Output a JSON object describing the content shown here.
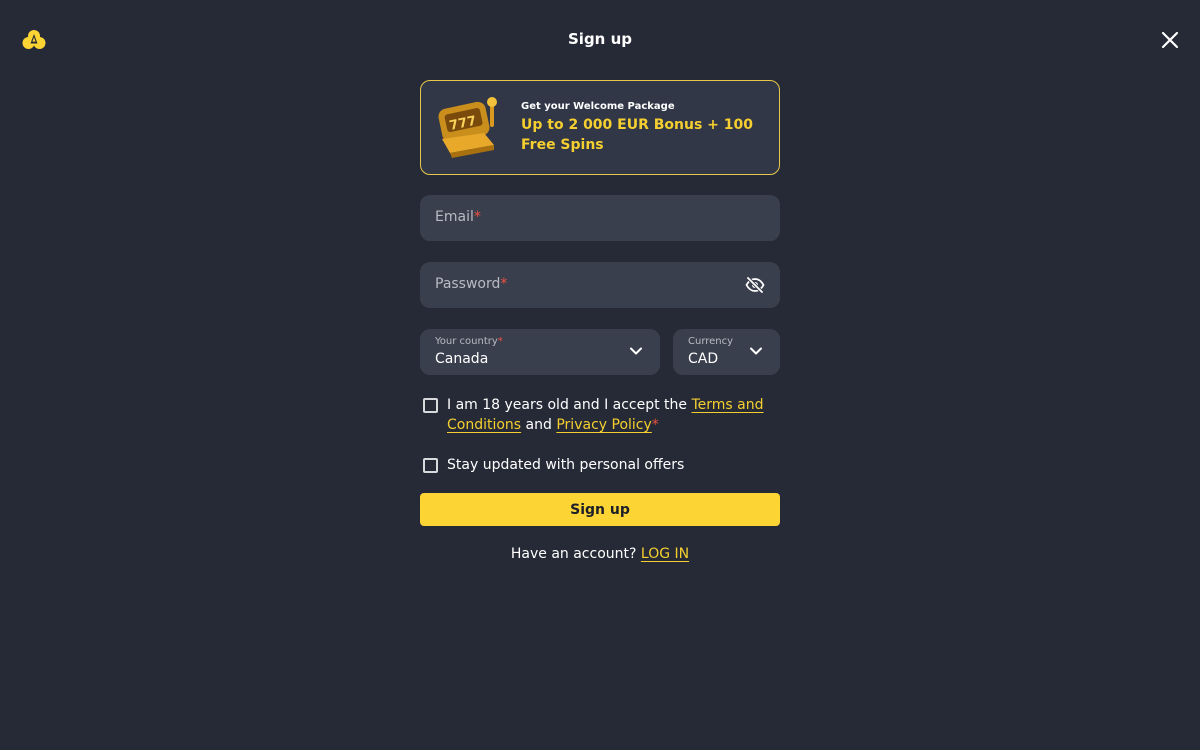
{
  "header": {
    "title": "Sign up",
    "accent_color": "#fcd535"
  },
  "promo": {
    "small_text": "Get your Welcome Package",
    "big_text": "Up to 2 000 EUR Bonus + 100 Free Spins"
  },
  "fields": {
    "email": {
      "placeholder": "Email",
      "required_mark": "*"
    },
    "password": {
      "placeholder": "Password",
      "required_mark": "*"
    }
  },
  "country": {
    "label": "Your country",
    "required_mark": "*",
    "value": "Canada"
  },
  "currency": {
    "label": "Currency",
    "value": "CAD"
  },
  "consent": {
    "text_before": "I am 18 years old and I accept the ",
    "terms_link": "Terms and Conditions",
    "text_middle": " and ",
    "privacy_link": "Privacy Policy",
    "required_mark": "*"
  },
  "offers": {
    "label": "Stay updated with personal offers"
  },
  "signup_button": {
    "label": "Sign up"
  },
  "login": {
    "text": "Have an account?",
    "link": "LOG IN"
  }
}
